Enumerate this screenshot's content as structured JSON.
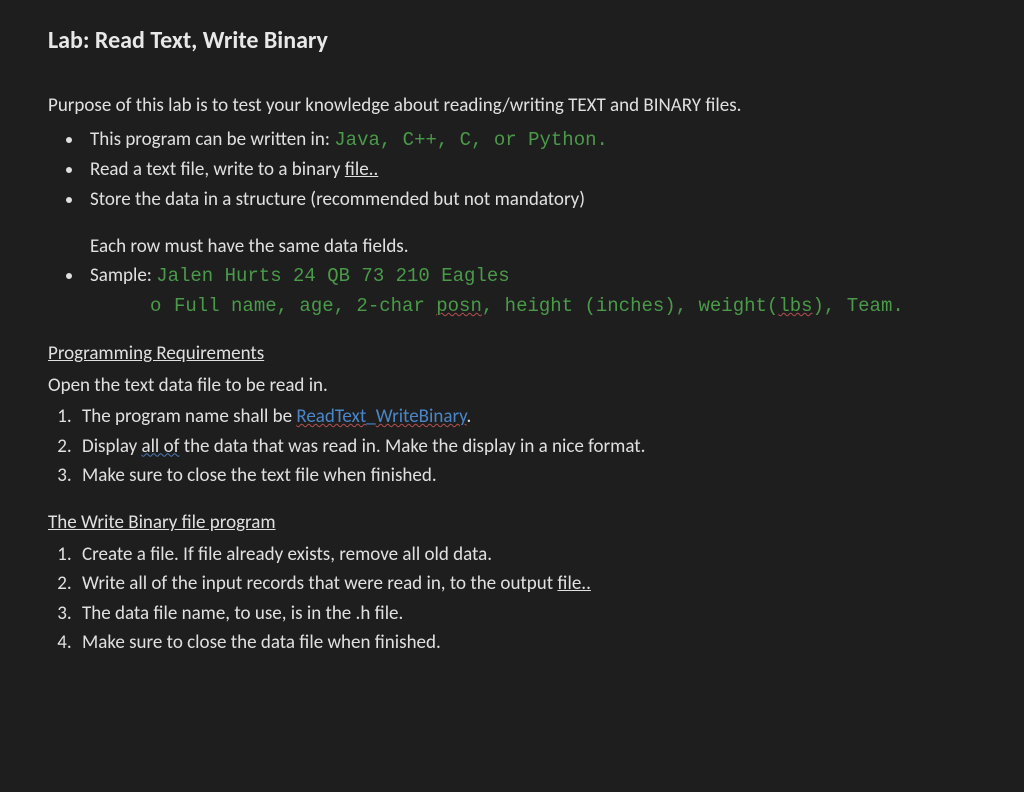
{
  "title": "Lab: Read Text, Write Binary",
  "lead": "Purpose of this lab is to test your knowledge about reading/writing TEXT and BINARY files.",
  "bullets": {
    "b1_pre": "This program can be written in: ",
    "b1_langs": "Java, C++, C, or Python.",
    "b2_pre": "Read a text file, write to a binary ",
    "b2_link": "file..",
    "b3": "Store the data in a structure (recommended but not mandatory)",
    "b3_after": "Each row must have the same data fields.",
    "b4_pre": "Sample: ",
    "b4_sample": "Jalen Hurts 24 QB 73 210 Eagles",
    "sub_marker": "o",
    "sub_p1": "Full name, age, 2-char ",
    "sub_posn": "posn",
    "sub_p2": ", height (inches), weight(",
    "sub_lbs": "lbs",
    "sub_p3": "), Team."
  },
  "req": {
    "head": "Programming Requirements",
    "open": "Open the text data file to be read in.",
    "r1_pre": "The program name shall be ",
    "r1_name_a": "ReadText",
    "r1_name_sep": "_",
    "r1_name_b": "WriteBinary",
    "r1_post": ".",
    "r2_pre": "Display ",
    "r2_all": "all of",
    "r2_post": " the data that was read in.  Make the display in a nice format.",
    "r3": "Make sure to close the text file when finished."
  },
  "wb": {
    "head": "The Write Binary file program",
    "w1": "Create a file.  If file already exists, remove all old data.",
    "w2_pre": "Write all of the input records that were read in, to the output ",
    "w2_link": "file..",
    "w3": "The data file name, to use, is in the .h file.",
    "w4": "Make sure to close the data file when finished."
  }
}
